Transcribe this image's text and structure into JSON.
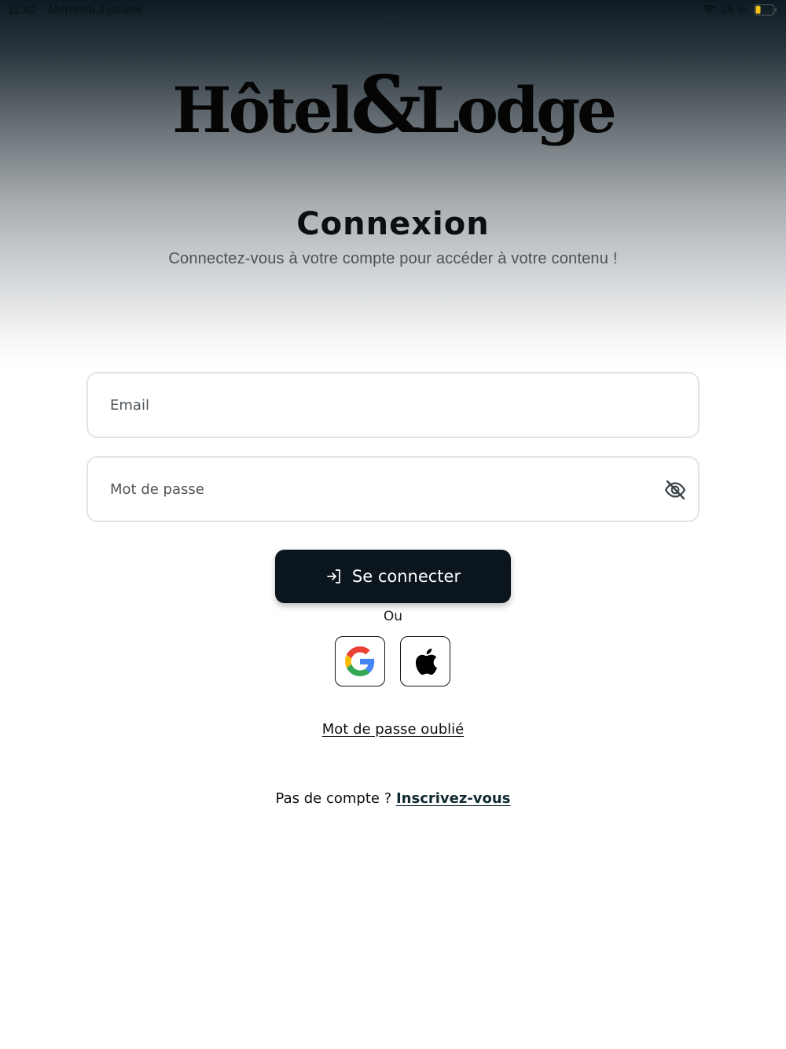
{
  "status_bar": {
    "time": "11:42",
    "date": "Mercredi 3 janvier",
    "battery_percent": "28 %",
    "battery_level": 0.28,
    "battery_color": "#f5c518"
  },
  "brand": {
    "logo_part1": "Hôtel",
    "logo_amp": "&",
    "logo_part2": "Lodge"
  },
  "header": {
    "title": "Connexion",
    "subtitle": "Connectez-vous à votre compte pour accéder à votre contenu !"
  },
  "form": {
    "email_placeholder": "Email",
    "email_value": "",
    "password_placeholder": "Mot de passe",
    "password_value": "",
    "password_toggle_icon": "eye-slash-icon"
  },
  "actions": {
    "login_label": "Se connecter",
    "login_icon": "login-arrow-icon",
    "or_label": "Ou",
    "social": [
      {
        "name": "Google",
        "icon": "google-icon"
      },
      {
        "name": "Apple",
        "icon": "apple-icon"
      }
    ],
    "forgot_password": "Mot de passe oublié",
    "no_account_text": "Pas de compte ?",
    "signup_link": "Inscrivez-vous"
  },
  "colors": {
    "primary_dark": "#0a151d",
    "signup_link": "#112a33",
    "field_border": "#e3e4e6"
  }
}
